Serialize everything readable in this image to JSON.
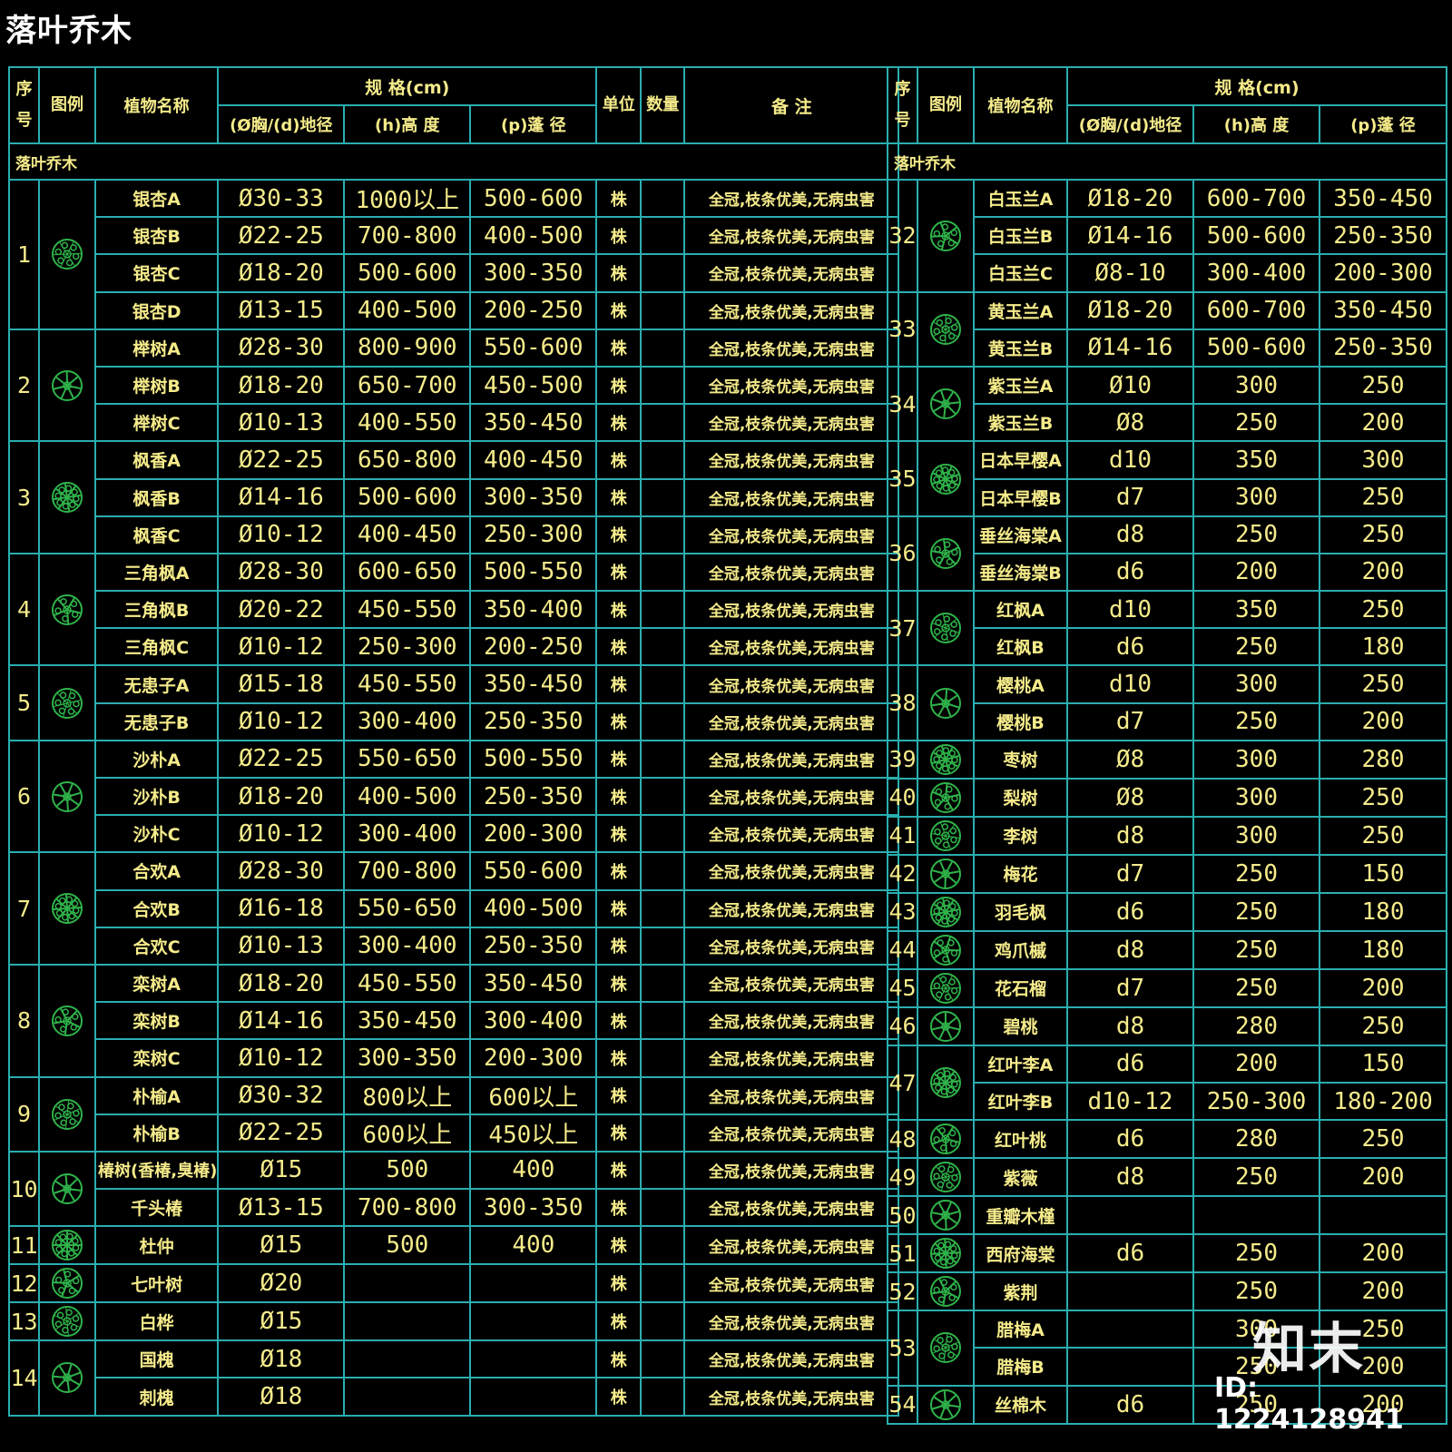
{
  "page_title": "落叶乔木",
  "header": {
    "seq": "序号",
    "legend": "图例",
    "name": "植物名称",
    "spec": "规 格(cm)",
    "diameter": "(Ø胸/(d)地径",
    "height": "(h)高 度",
    "crown": "(p)蓬 径",
    "unit": "单位",
    "qty": "数量",
    "remark": "备 注"
  },
  "category_label": "落叶乔木",
  "colors": {
    "grid": "#2aaeb0",
    "text": "#f5eb8a",
    "symbol": "#2fb34a",
    "background": "#000000"
  },
  "left_groups": [
    {
      "no": "1",
      "icon": "tree-symbol-1",
      "rows": [
        {
          "name": "银杏A",
          "d": "Ø30-33",
          "h": "1000以上",
          "p": "500-600",
          "unit": "株",
          "remark": "全冠,枝条优美,无病虫害"
        },
        {
          "name": "银杏B",
          "d": "Ø22-25",
          "h": "700-800",
          "p": "400-500",
          "unit": "株",
          "remark": "全冠,枝条优美,无病虫害"
        },
        {
          "name": "银杏C",
          "d": "Ø18-20",
          "h": "500-600",
          "p": "300-350",
          "unit": "株",
          "remark": "全冠,枝条优美,无病虫害"
        },
        {
          "name": "银杏D",
          "d": "Ø13-15",
          "h": "400-500",
          "p": "200-250",
          "unit": "株",
          "remark": "全冠,枝条优美,无病虫害"
        }
      ]
    },
    {
      "no": "2",
      "icon": "tree-symbol-2",
      "rows": [
        {
          "name": "榉树A",
          "d": "Ø28-30",
          "h": "800-900",
          "p": "550-600",
          "unit": "株",
          "remark": "全冠,枝条优美,无病虫害"
        },
        {
          "name": "榉树B",
          "d": "Ø18-20",
          "h": "650-700",
          "p": "450-500",
          "unit": "株",
          "remark": "全冠,枝条优美,无病虫害"
        },
        {
          "name": "榉树C",
          "d": "Ø10-13",
          "h": "400-550",
          "p": "350-450",
          "unit": "株",
          "remark": "全冠,枝条优美,无病虫害"
        }
      ]
    },
    {
      "no": "3",
      "icon": "tree-symbol-3",
      "rows": [
        {
          "name": "枫香A",
          "d": "Ø22-25",
          "h": "650-800",
          "p": "400-450",
          "unit": "株",
          "remark": "全冠,枝条优美,无病虫害"
        },
        {
          "name": "枫香B",
          "d": "Ø14-16",
          "h": "500-600",
          "p": "300-350",
          "unit": "株",
          "remark": "全冠,枝条优美,无病虫害"
        },
        {
          "name": "枫香C",
          "d": "Ø10-12",
          "h": "400-450",
          "p": "250-300",
          "unit": "株",
          "remark": "全冠,枝条优美,无病虫害"
        }
      ]
    },
    {
      "no": "4",
      "icon": "tree-symbol-4",
      "rows": [
        {
          "name": "三角枫A",
          "d": "Ø28-30",
          "h": "600-650",
          "p": "500-550",
          "unit": "株",
          "remark": "全冠,枝条优美,无病虫害"
        },
        {
          "name": "三角枫B",
          "d": "Ø20-22",
          "h": "450-550",
          "p": "350-400",
          "unit": "株",
          "remark": "全冠,枝条优美,无病虫害"
        },
        {
          "name": "三角枫C",
          "d": "Ø10-12",
          "h": "250-300",
          "p": "200-250",
          "unit": "株",
          "remark": "全冠,枝条优美,无病虫害"
        }
      ]
    },
    {
      "no": "5",
      "icon": "tree-symbol-5",
      "rows": [
        {
          "name": "无患子A",
          "d": "Ø15-18",
          "h": "450-550",
          "p": "350-450",
          "unit": "株",
          "remark": "全冠,枝条优美,无病虫害"
        },
        {
          "name": "无患子B",
          "d": "Ø10-12",
          "h": "300-400",
          "p": "250-350",
          "unit": "株",
          "remark": "全冠,枝条优美,无病虫害"
        }
      ]
    },
    {
      "no": "6",
      "icon": "tree-symbol-6",
      "rows": [
        {
          "name": "沙朴A",
          "d": "Ø22-25",
          "h": "550-650",
          "p": "500-550",
          "unit": "株",
          "remark": "全冠,枝条优美,无病虫害"
        },
        {
          "name": "沙朴B",
          "d": "Ø18-20",
          "h": "400-500",
          "p": "250-350",
          "unit": "株",
          "remark": "全冠,枝条优美,无病虫害"
        },
        {
          "name": "沙朴C",
          "d": "Ø10-12",
          "h": "300-400",
          "p": "200-300",
          "unit": "株",
          "remark": "全冠,枝条优美,无病虫害"
        }
      ]
    },
    {
      "no": "7",
      "icon": "tree-symbol-7",
      "rows": [
        {
          "name": "合欢A",
          "d": "Ø28-30",
          "h": "700-800",
          "p": "550-600",
          "unit": "株",
          "remark": "全冠,枝条优美,无病虫害"
        },
        {
          "name": "合欢B",
          "d": "Ø16-18",
          "h": "550-650",
          "p": "400-500",
          "unit": "株",
          "remark": "全冠,枝条优美,无病虫害"
        },
        {
          "name": "合欢C",
          "d": "Ø10-13",
          "h": "300-400",
          "p": "250-350",
          "unit": "株",
          "remark": "全冠,枝条优美,无病虫害"
        }
      ]
    },
    {
      "no": "8",
      "icon": "tree-symbol-8",
      "rows": [
        {
          "name": "栾树A",
          "d": "Ø18-20",
          "h": "450-550",
          "p": "350-450",
          "unit": "株",
          "remark": "全冠,枝条优美,无病虫害"
        },
        {
          "name": "栾树B",
          "d": "Ø14-16",
          "h": "350-450",
          "p": "300-400",
          "unit": "株",
          "remark": "全冠,枝条优美,无病虫害"
        },
        {
          "name": "栾树C",
          "d": "Ø10-12",
          "h": "300-350",
          "p": "200-300",
          "unit": "株",
          "remark": "全冠,枝条优美,无病虫害"
        }
      ]
    },
    {
      "no": "9",
      "icon": "tree-symbol-9",
      "rows": [
        {
          "name": "朴榆A",
          "d": "Ø30-32",
          "h": "800以上",
          "p": "600以上",
          "unit": "株",
          "remark": "全冠,枝条优美,无病虫害"
        },
        {
          "name": "朴榆B",
          "d": "Ø22-25",
          "h": "600以上",
          "p": "450以上",
          "unit": "株",
          "remark": "全冠,枝条优美,无病虫害"
        }
      ]
    },
    {
      "no": "10",
      "icon": "tree-symbol-10",
      "rows": [
        {
          "name": "椿树(香椿,臭椿)",
          "d": "Ø15",
          "h": "500",
          "p": "400",
          "unit": "株",
          "remark": "全冠,枝条优美,无病虫害"
        },
        {
          "name": "千头椿",
          "d": "Ø13-15",
          "h": "700-800",
          "p": "300-350",
          "unit": "株",
          "remark": "全冠,枝条优美,无病虫害"
        }
      ]
    },
    {
      "no": "11",
      "icon": "tree-symbol-11",
      "rows": [
        {
          "name": "杜仲",
          "d": "Ø15",
          "h": "500",
          "p": "400",
          "unit": "株",
          "remark": "全冠,枝条优美,无病虫害"
        }
      ]
    },
    {
      "no": "12",
      "icon": "tree-symbol-12",
      "rows": [
        {
          "name": "七叶树",
          "d": "Ø20",
          "h": "",
          "p": "",
          "unit": "株",
          "remark": "全冠,枝条优美,无病虫害"
        }
      ]
    },
    {
      "no": "13",
      "icon": "tree-symbol-13",
      "rows": [
        {
          "name": "白桦",
          "d": "Ø15",
          "h": "",
          "p": "",
          "unit": "株",
          "remark": "全冠,枝条优美,无病虫害"
        }
      ]
    },
    {
      "no": "14",
      "icon": "tree-symbol-14",
      "rows": [
        {
          "name": "国槐",
          "d": "Ø18",
          "h": "",
          "p": "",
          "unit": "株",
          "remark": "全冠,枝条优美,无病虫害"
        },
        {
          "name": "刺槐",
          "d": "Ø18",
          "h": "",
          "p": "",
          "unit": "株",
          "remark": "全冠,枝条优美,无病虫害"
        }
      ]
    }
  ],
  "right_groups": [
    {
      "no": "32",
      "icon": "tree-symbol-32",
      "rows": [
        {
          "name": "白玉兰A",
          "d": "Ø18-20",
          "h": "600-700",
          "p": "350-450"
        },
        {
          "name": "白玉兰B",
          "d": "Ø14-16",
          "h": "500-600",
          "p": "250-350"
        },
        {
          "name": "白玉兰C",
          "d": "Ø8-10",
          "h": "300-400",
          "p": "200-300"
        }
      ]
    },
    {
      "no": "33",
      "icon": "tree-symbol-33",
      "rows": [
        {
          "name": "黄玉兰A",
          "d": "Ø18-20",
          "h": "600-700",
          "p": "350-450"
        },
        {
          "name": "黄玉兰B",
          "d": "Ø14-16",
          "h": "500-600",
          "p": "250-350"
        }
      ]
    },
    {
      "no": "34",
      "icon": "tree-symbol-34",
      "rows": [
        {
          "name": "紫玉兰A",
          "d": "Ø10",
          "h": "300",
          "p": "250"
        },
        {
          "name": "紫玉兰B",
          "d": "Ø8",
          "h": "250",
          "p": "200"
        }
      ]
    },
    {
      "no": "35",
      "icon": "tree-symbol-35",
      "rows": [
        {
          "name": "日本早樱A",
          "d": "d10",
          "h": "350",
          "p": "300"
        },
        {
          "name": "日本早樱B",
          "d": "d7",
          "h": "300",
          "p": "250"
        }
      ]
    },
    {
      "no": "36",
      "icon": "tree-symbol-36",
      "rows": [
        {
          "name": "垂丝海棠A",
          "d": "d8",
          "h": "250",
          "p": "250"
        },
        {
          "name": "垂丝海棠B",
          "d": "d6",
          "h": "200",
          "p": "200"
        }
      ]
    },
    {
      "no": "37",
      "icon": "tree-symbol-37",
      "rows": [
        {
          "name": "红枫A",
          "d": "d10",
          "h": "350",
          "p": "250"
        },
        {
          "name": "红枫B",
          "d": "d6",
          "h": "250",
          "p": "180"
        }
      ]
    },
    {
      "no": "38",
      "icon": "tree-symbol-38",
      "rows": [
        {
          "name": "樱桃A",
          "d": "d10",
          "h": "300",
          "p": "250"
        },
        {
          "name": "樱桃B",
          "d": "d7",
          "h": "250",
          "p": "200"
        }
      ]
    },
    {
      "no": "39",
      "icon": "tree-symbol-39",
      "rows": [
        {
          "name": "枣树",
          "d": "Ø8",
          "h": "300",
          "p": "280"
        }
      ]
    },
    {
      "no": "40",
      "icon": "tree-symbol-40",
      "rows": [
        {
          "name": "梨树",
          "d": "Ø8",
          "h": "300",
          "p": "250"
        }
      ]
    },
    {
      "no": "41",
      "icon": "tree-symbol-41",
      "rows": [
        {
          "name": "李树",
          "d": "d8",
          "h": "300",
          "p": "250"
        }
      ]
    },
    {
      "no": "42",
      "icon": "tree-symbol-42",
      "rows": [
        {
          "name": "梅花",
          "d": "d7",
          "h": "250",
          "p": "150"
        }
      ]
    },
    {
      "no": "43",
      "icon": "tree-symbol-43",
      "rows": [
        {
          "name": "羽毛枫",
          "d": "d6",
          "h": "250",
          "p": "180"
        }
      ]
    },
    {
      "no": "44",
      "icon": "tree-symbol-44",
      "rows": [
        {
          "name": "鸡爪槭",
          "d": "d8",
          "h": "250",
          "p": "180"
        }
      ]
    },
    {
      "no": "45",
      "icon": "tree-symbol-45",
      "rows": [
        {
          "name": "花石榴",
          "d": "d7",
          "h": "250",
          "p": "200"
        }
      ]
    },
    {
      "no": "46",
      "icon": "tree-symbol-46",
      "rows": [
        {
          "name": "碧桃",
          "d": "d8",
          "h": "280",
          "p": "250"
        }
      ]
    },
    {
      "no": "47",
      "icon": "tree-symbol-47",
      "rows": [
        {
          "name": "红叶李A",
          "d": "d6",
          "h": "200",
          "p": "150"
        },
        {
          "name": "红叶李B",
          "d": "d10-12",
          "h": "250-300",
          "p": "180-200"
        }
      ]
    },
    {
      "no": "48",
      "icon": "tree-symbol-48",
      "rows": [
        {
          "name": "红叶桃",
          "d": "d6",
          "h": "280",
          "p": "250"
        }
      ]
    },
    {
      "no": "49",
      "icon": "tree-symbol-49",
      "rows": [
        {
          "name": "紫薇",
          "d": "d8",
          "h": "250",
          "p": "200"
        }
      ]
    },
    {
      "no": "50",
      "icon": "tree-symbol-50",
      "rows": [
        {
          "name": "重瓣木槿",
          "d": "",
          "h": "",
          "p": ""
        }
      ]
    },
    {
      "no": "51",
      "icon": "tree-symbol-51",
      "rows": [
        {
          "name": "西府海棠",
          "d": "d6",
          "h": "250",
          "p": "200"
        }
      ]
    },
    {
      "no": "52",
      "icon": "tree-symbol-52",
      "rows": [
        {
          "name": "紫荆",
          "d": "",
          "h": "250",
          "p": "200"
        }
      ]
    },
    {
      "no": "53",
      "icon": "tree-symbol-53",
      "rows": [
        {
          "name": "腊梅A",
          "d": "",
          "h": "300",
          "p": "250"
        },
        {
          "name": "腊梅B",
          "d": "",
          "h": "250",
          "p": "200"
        }
      ]
    },
    {
      "no": "54",
      "icon": "tree-symbol-54",
      "rows": [
        {
          "name": "丝棉木",
          "d": "d6",
          "h": "250",
          "p": "200"
        }
      ]
    }
  ],
  "watermark": {
    "logo": "知末",
    "id": "ID: 1224128941"
  }
}
